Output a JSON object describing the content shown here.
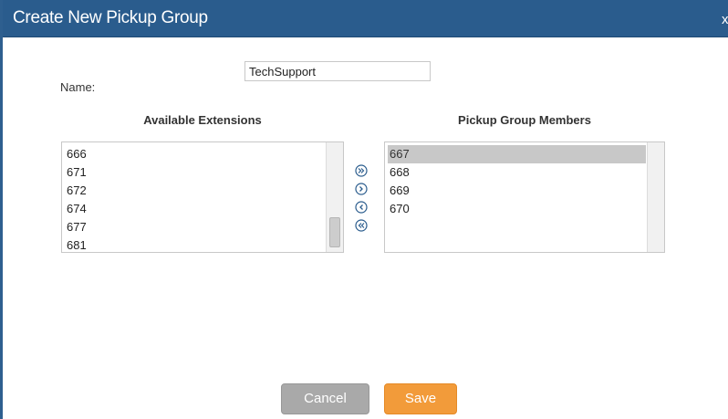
{
  "dialog": {
    "title": "Create New Pickup Group",
    "close_label": "x"
  },
  "form": {
    "name_label": "Name:",
    "name_value": "TechSupport"
  },
  "available": {
    "heading": "Available Extensions",
    "items": [
      "666",
      "671",
      "672",
      "674",
      "677",
      "681"
    ]
  },
  "members": {
    "heading": "Pickup Group Members",
    "items": [
      "667",
      "668",
      "669",
      "670"
    ],
    "selected": "667"
  },
  "transfer_buttons": [
    {
      "name": "add-all-icon",
      "glyph": "double-right"
    },
    {
      "name": "add-selected-icon",
      "glyph": "right"
    },
    {
      "name": "remove-selected-icon",
      "glyph": "left"
    },
    {
      "name": "remove-all-icon",
      "glyph": "double-left"
    }
  ],
  "footer": {
    "cancel_label": "Cancel",
    "save_label": "Save"
  },
  "colors": {
    "titlebar": "#2a5c8d",
    "save": "#f29b3a",
    "cancel": "#a9a9a9",
    "icon": "#2a5c8d"
  }
}
